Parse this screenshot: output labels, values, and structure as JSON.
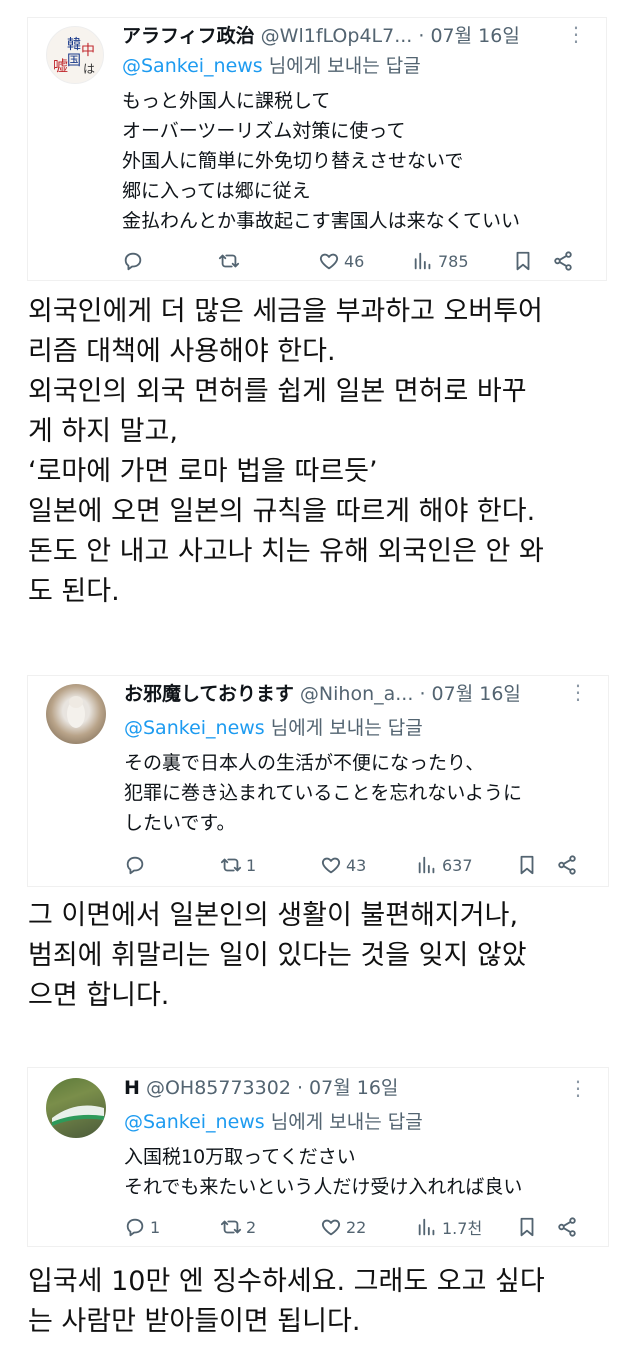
{
  "tweets": [
    {
      "name": "アラフィフ政治",
      "handle": "@Wl1fLOp4L7...",
      "dot": "·",
      "date": "07월 16일",
      "reply_mention": "@Sankei_news",
      "reply_suffix": " 님에게 보내는 답글",
      "body": [
        "もっと外国人に課税して",
        "オーバーツーリズム対策に使って",
        "外国人に簡単に外免切り替えさせないで",
        "郷に入っては郷に従え",
        "金払わんとか事故起こす害国人は来なくていい"
      ],
      "avatar_text": [
        "韓",
        "中",
        "国",
        "嘘",
        "は"
      ],
      "replies": "",
      "retweets": "",
      "likes": "46",
      "views": "785",
      "translation": [
        "외국인에게 더 많은 세금을 부과하고 오버투어",
        "리즘 대책에 사용해야 한다.",
        "외국인의 외국 면허를 쉽게 일본 면허로 바꾸",
        "게 하지 말고,",
        "‘로마에 가면 로마 법을 따르듯’",
        "일본에 오면 일본의 규칙을 따르게 해야 한다.",
        "돈도 안 내고 사고나 치는 유해 외국인은 안 와",
        "도 된다."
      ]
    },
    {
      "name": "お邪魔しております",
      "handle": "@Nihon_a...",
      "dot": "·",
      "date": "07월 16일",
      "reply_mention": "@Sankei_news",
      "reply_suffix": " 님에게 보내는 답글",
      "body": [
        "その裏で日本人の生活が不便になったり、",
        "犯罪に巻き込まれていることを忘れないように",
        "したいです。"
      ],
      "replies": "",
      "retweets": "1",
      "likes": "43",
      "views": "637",
      "translation": [
        "그 이면에서 일본인의 생활이 불편해지거나,",
        "범죄에 휘말리는 일이 있다는 것을 잊지 않았",
        "으면 합니다."
      ]
    },
    {
      "name": "H",
      "handle": "@OH85773302",
      "dot": "·",
      "date": "07월 16일",
      "reply_mention": "@Sankei_news",
      "reply_suffix": " 님에게 보내는 답글",
      "body": [
        "入国税10万取ってください",
        "それでも来たいという人だけ受け入れれば良い"
      ],
      "replies": "1",
      "retweets": "2",
      "likes": "22",
      "views": "1.7천",
      "translation": [
        "입국세 10만 엔 징수하세요. 그래도 오고 싶다",
        "는 사람만 받아들이면 됩니다."
      ]
    }
  ],
  "colors": {
    "link": "#1d9bf0",
    "muted": "#536471",
    "text": "#0f1419"
  },
  "icons": [
    "reply-icon",
    "retweet-icon",
    "like-icon",
    "views-icon",
    "bookmark-icon",
    "share-icon",
    "more-options-icon"
  ]
}
